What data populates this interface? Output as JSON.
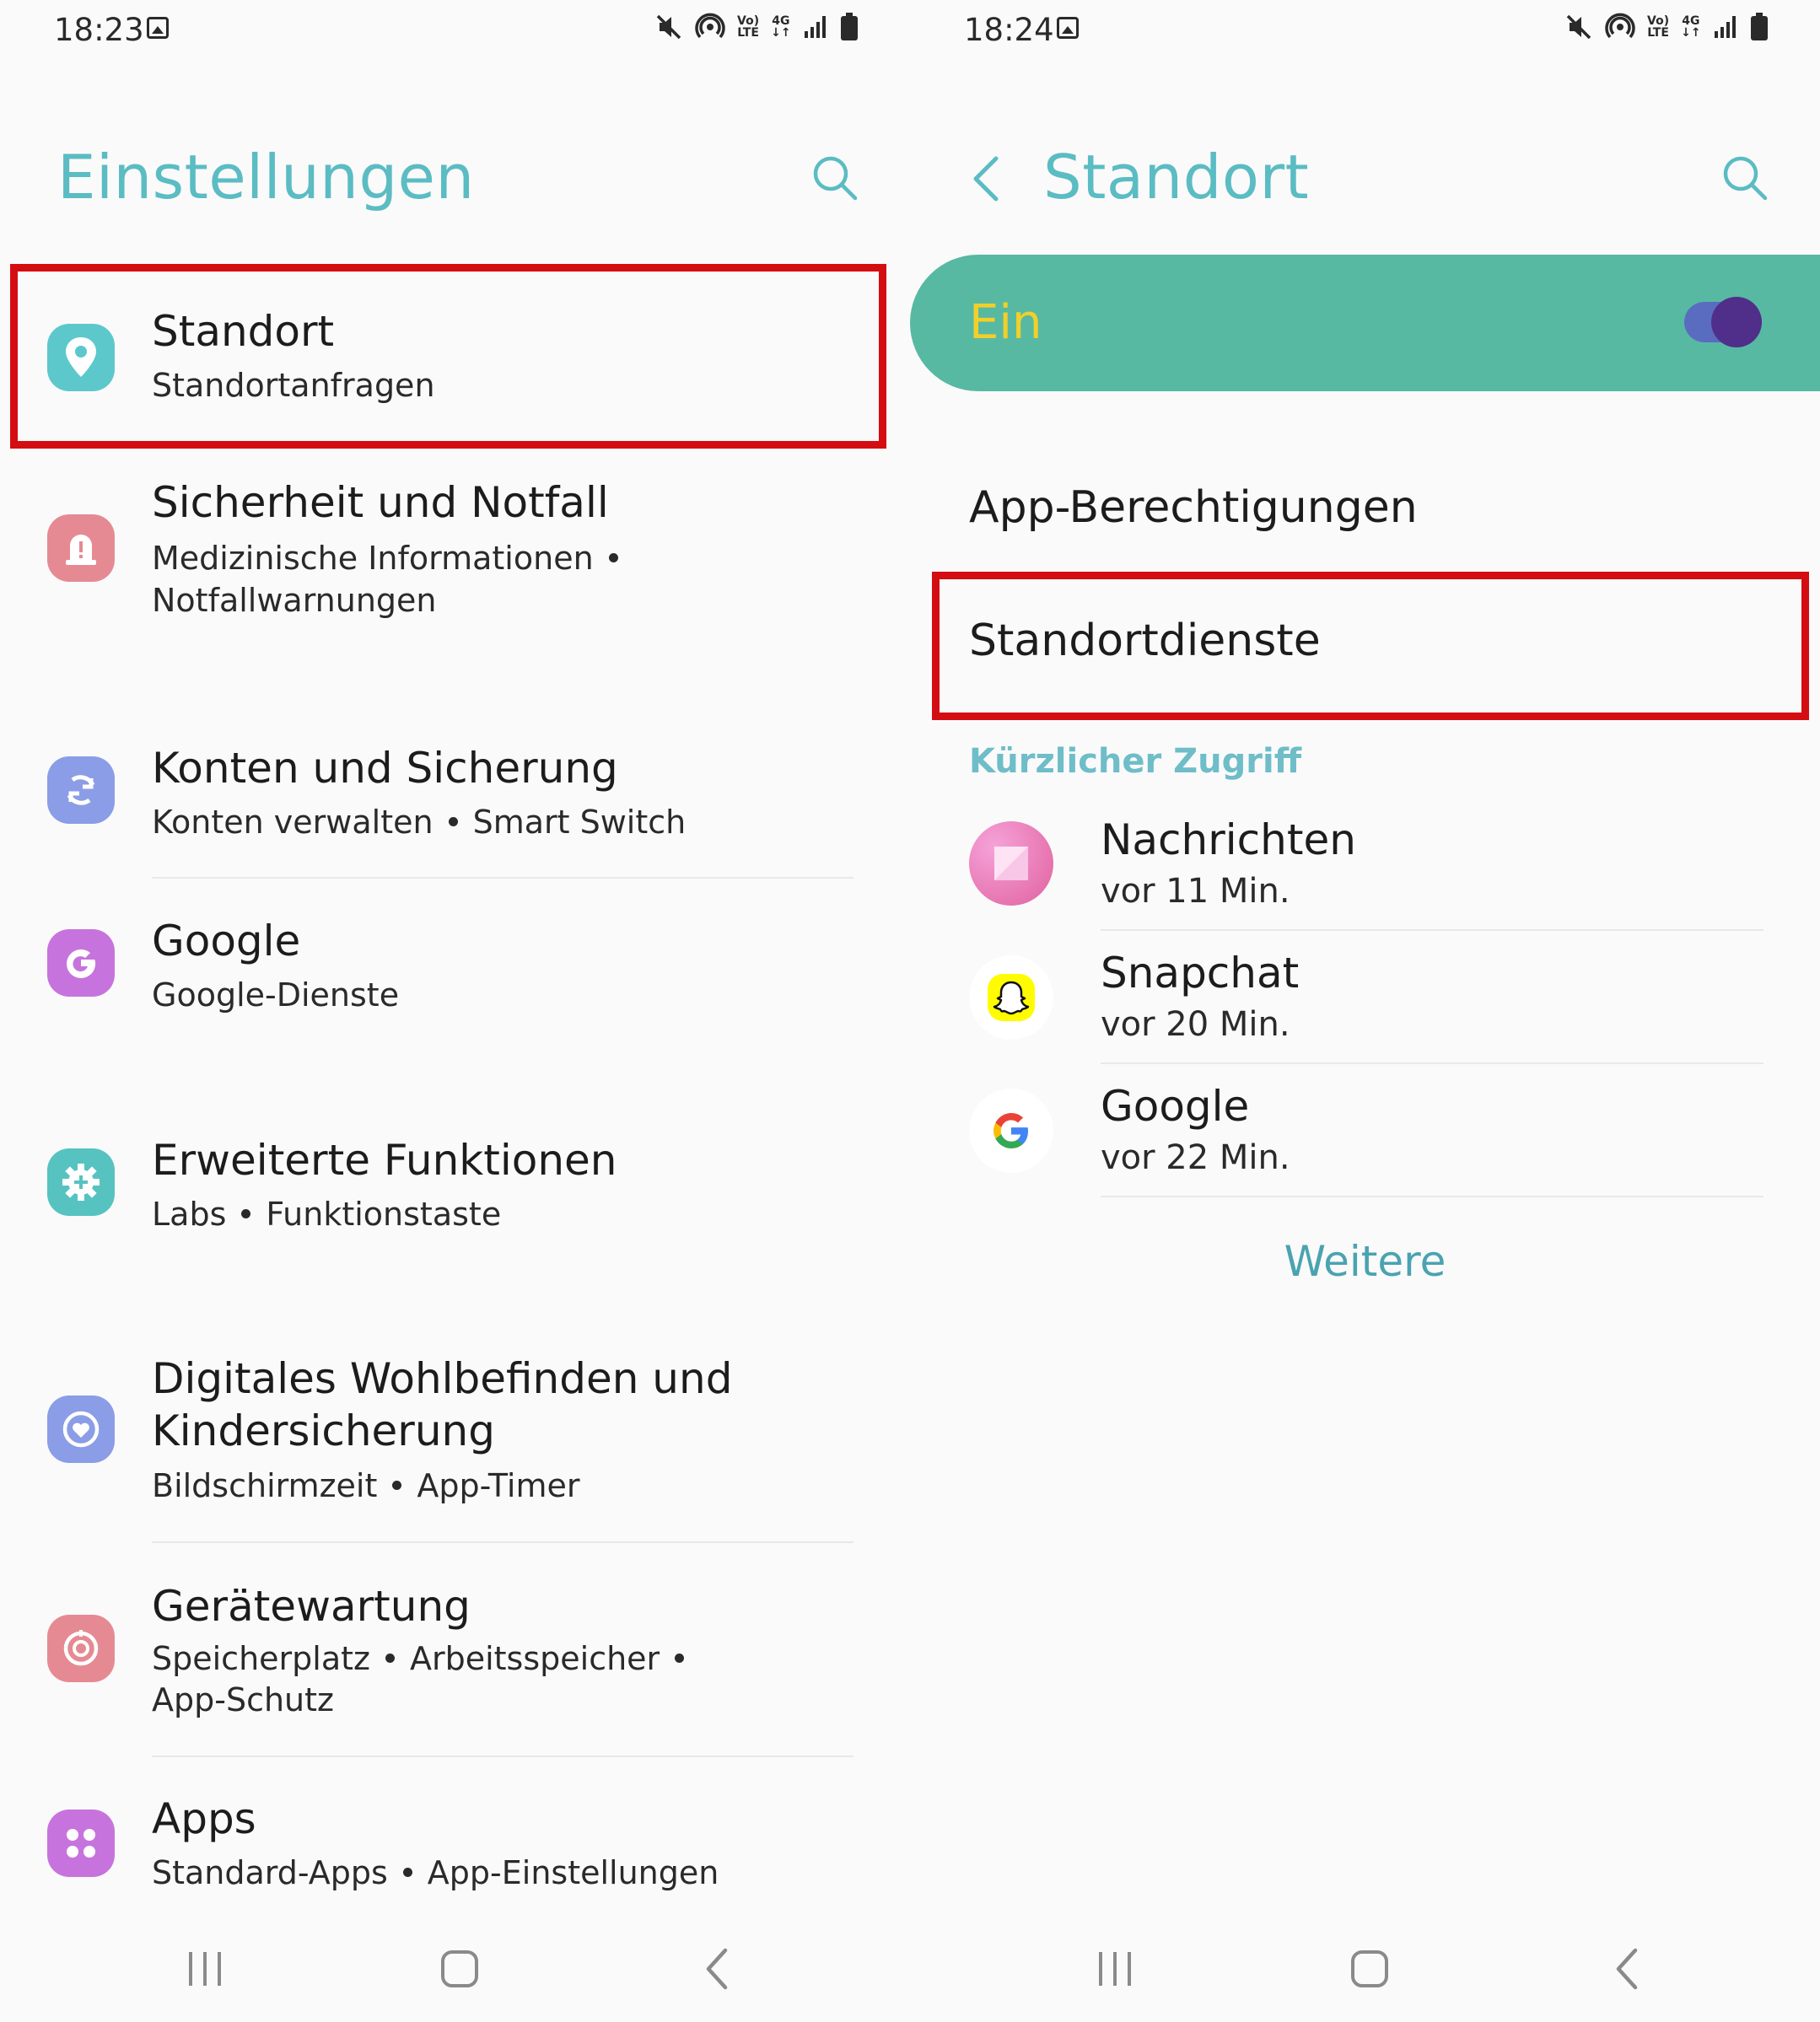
{
  "left": {
    "status": {
      "time": "18:23"
    },
    "title": "Einstellungen",
    "items": [
      {
        "title": "Standort",
        "subtitle": [
          "Standortanfragen"
        ],
        "icon": "location-pin-icon",
        "color": "#5cc8cc"
      },
      {
        "title": "Sicherheit und Notfall",
        "subtitle": [
          "Medizinische Informationen",
          "Notfallwarnungen"
        ],
        "icon": "alert-siren-icon",
        "color": "#e58a93"
      },
      {
        "title": "Konten und Sicherung",
        "subtitle": [
          "Konten verwalten",
          "Smart Switch"
        ],
        "icon": "sync-icon",
        "color": "#8b9de6"
      },
      {
        "title": "Google",
        "subtitle": [
          "Google-Dienste"
        ],
        "icon": "google-g-icon",
        "color": "#c773dd"
      },
      {
        "title": "Erweiterte Funktionen",
        "subtitle": [
          "Labs",
          "Funktionstaste"
        ],
        "icon": "gear-plus-icon",
        "color": "#56c3c0"
      },
      {
        "title_line1": "Digitales Wohlbefinden und",
        "title_line2": "Kindersicherung",
        "subtitle": [
          "Bildschirmzeit",
          "App-Timer"
        ],
        "icon": "wellbeing-heart-icon",
        "color": "#8b9de6"
      },
      {
        "title": "Gerätewartung",
        "subtitle": [
          "Speicherplatz",
          "Arbeitsspeicher",
          "App-Schutz"
        ],
        "icon": "device-care-icon",
        "color": "#e58a93"
      },
      {
        "title": "Apps",
        "subtitle": [
          "Standard-Apps",
          "App-Einstellungen"
        ],
        "icon": "apps-grid-icon",
        "color": "#c773dd"
      }
    ]
  },
  "right": {
    "status": {
      "time": "18:24"
    },
    "title": "Standort",
    "toggle": {
      "label": "Ein",
      "on": true
    },
    "menu": [
      "App-Berechtigungen",
      "Standortdienste"
    ],
    "recent_header": "Kürzlicher Zugriff",
    "recent": [
      {
        "name": "Nachrichten",
        "time": "vor 11 Min.",
        "icon": "messages-icon"
      },
      {
        "name": "Snapchat",
        "time": "vor 20 Min.",
        "icon": "snapchat-ghost-icon"
      },
      {
        "name": "Google",
        "time": "vor 22 Min.",
        "icon": "google-logo-icon"
      }
    ],
    "more": "Weitere"
  },
  "status_icons": {
    "lte_top": "Vo)",
    "lte_bottom": "LTE",
    "net": "4G"
  },
  "colors": {
    "accent": "#5bbcc3",
    "toggle_bg": "#57b9a2",
    "toggle_label": "#f2cf2a",
    "highlight": "#d40d12",
    "link": "#4aa3b0"
  }
}
